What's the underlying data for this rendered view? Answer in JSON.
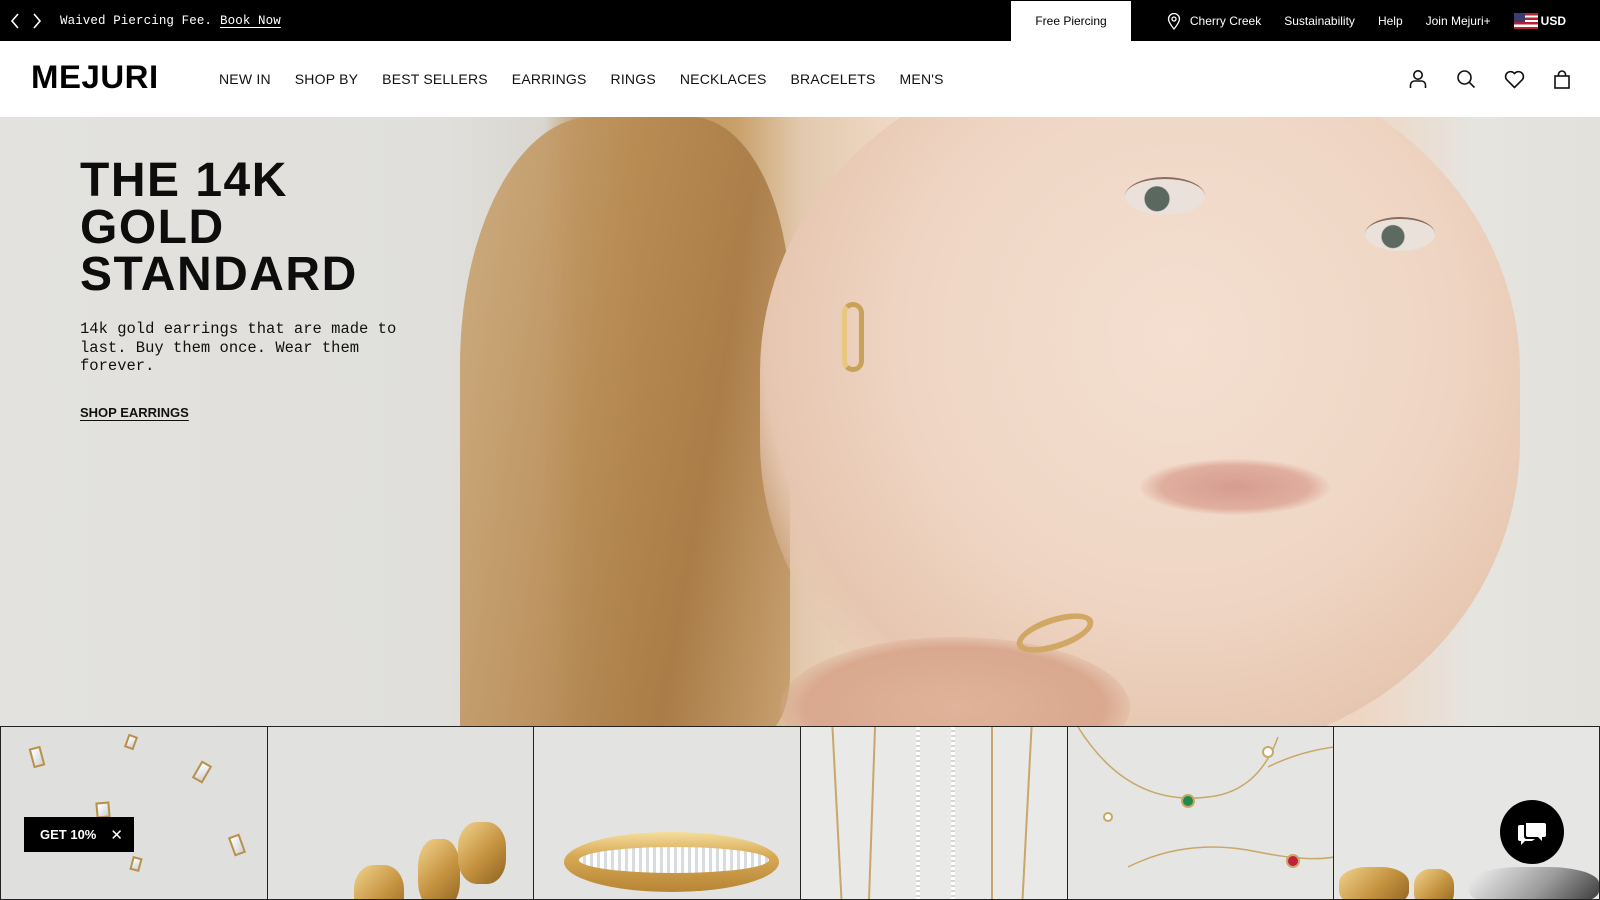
{
  "announcement": {
    "prev_icon": "chevron-left-icon",
    "next_icon": "chevron-right-icon",
    "promo_text": "Waived Piercing Fee.",
    "promo_link": "Book Now",
    "free_piercing": "Free Piercing"
  },
  "utility_nav": {
    "location": "Cherry Creek",
    "location_icon": "map-pin-icon",
    "sustainability": "Sustainability",
    "help": "Help",
    "join": "Join Mejuri+",
    "currency": "USD"
  },
  "header": {
    "logo": "MEJURI",
    "nav": [
      "NEW IN",
      "SHOP BY",
      "BEST SELLERS",
      "EARRINGS",
      "RINGS",
      "NECKLACES",
      "BRACELETS",
      "MEN'S"
    ],
    "icons": [
      "account-icon",
      "search-icon",
      "wishlist-heart-icon",
      "shopping-bag-icon"
    ]
  },
  "hero": {
    "title_line1": "THE 14K",
    "title_line2": "GOLD",
    "title_line3": "STANDARD",
    "subtitle": "14k gold earrings that are made to last. Buy them once. Wear them forever.",
    "cta": "SHOP EARRINGS"
  },
  "promo_popup": {
    "label": "GET 10%",
    "close_icon": "close-icon"
  },
  "chat": {
    "icon": "chat-bubble-icon"
  }
}
